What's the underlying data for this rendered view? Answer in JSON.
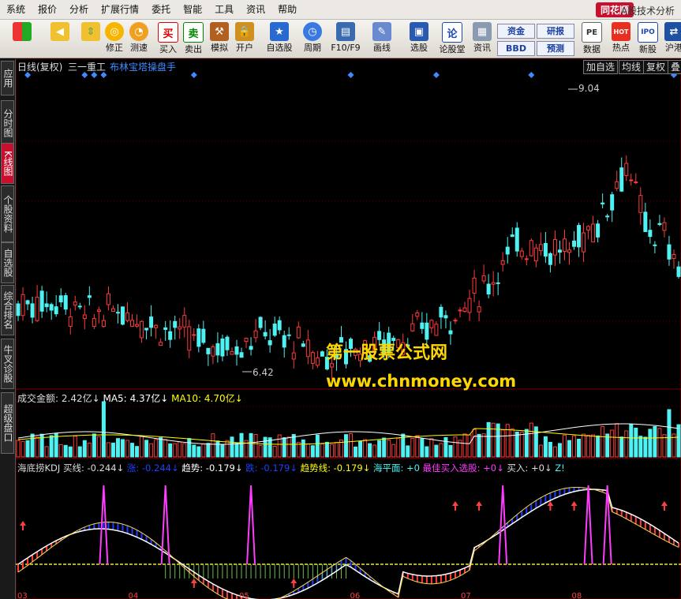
{
  "menu": [
    "系统",
    "报价",
    "分析",
    "扩展行情",
    "委托",
    "智能",
    "工具",
    "资讯",
    "帮助"
  ],
  "brand": "同花顺",
  "app_subtitle": "- A股技术分析",
  "toolbar": {
    "buttons": [
      "修正",
      "测速",
      "买入",
      "卖出",
      "模拟",
      "开户",
      "自选股",
      "周期",
      "F10/F9",
      "画线",
      "选股",
      "论股堂",
      "资讯",
      "数据",
      "热点",
      "新股",
      "沪港"
    ],
    "buy_icon": "买",
    "sell_icon": "卖",
    "lungutang_icon": "论",
    "small": {
      "zijin": "资金",
      "yanbao": "研报",
      "bbd": "BBD",
      "yuce": "预测"
    },
    "icon_labels": {
      "pe": "PE",
      "hot": "HOT",
      "ipo": "IPO"
    }
  },
  "sidebar": [
    "应用",
    "分时图",
    "K线图",
    "个股资料",
    "自选股",
    "综合排名",
    "牛叉诊股",
    "超级盘口"
  ],
  "chart_header": {
    "period": "日线(复权)",
    "stock": "三一重工",
    "indicator": "布林宝塔操盘手",
    "right_buttons": [
      "加自选",
      "均线",
      "复权",
      "叠"
    ]
  },
  "price_labels": {
    "high": "9.04",
    "low": "6.42"
  },
  "volume_header": {
    "amount_label": "成交金额:",
    "amount_value": "2.42亿↓",
    "ma5_label": "MA5:",
    "ma5_value": "4.37亿↓",
    "ma10_label": "MA10:",
    "ma10_value": "4.70亿↓"
  },
  "kdj_header": {
    "name": "海底捞KDJ",
    "buy_label": "买线:",
    "buy_value": "-0.244↓",
    "rise_label": "涨:",
    "rise_value": "-0.244↓",
    "trend_label": "趋势:",
    "trend_value": "-0.179↓",
    "fall_label": "跌:",
    "fall_value": "-0.179↓",
    "trendline_label": "趋势线:",
    "trendline_value": "-0.179↓",
    "sea_label": "海平面:",
    "sea_value": "+0",
    "best_label": "最佳买入选股:",
    "best_value": "+0↓",
    "in_label": "买入:",
    "in_value": "+0↓",
    "zf_label": "Z!"
  },
  "x_axis_labels": [
    "03",
    "04",
    "05",
    "06",
    "07",
    "08"
  ],
  "watermark": {
    "line1": "第一股票公式网",
    "line2": "www.chnmoney.com"
  },
  "colors": {
    "up": "#ff3b3b",
    "down": "#4ff2f2",
    "ma_white": "#ffffff",
    "ma_yellow": "#ffff00",
    "accent": "#c8102e",
    "magenta": "#ff3cff",
    "blue_band": "#1e3cff"
  }
}
